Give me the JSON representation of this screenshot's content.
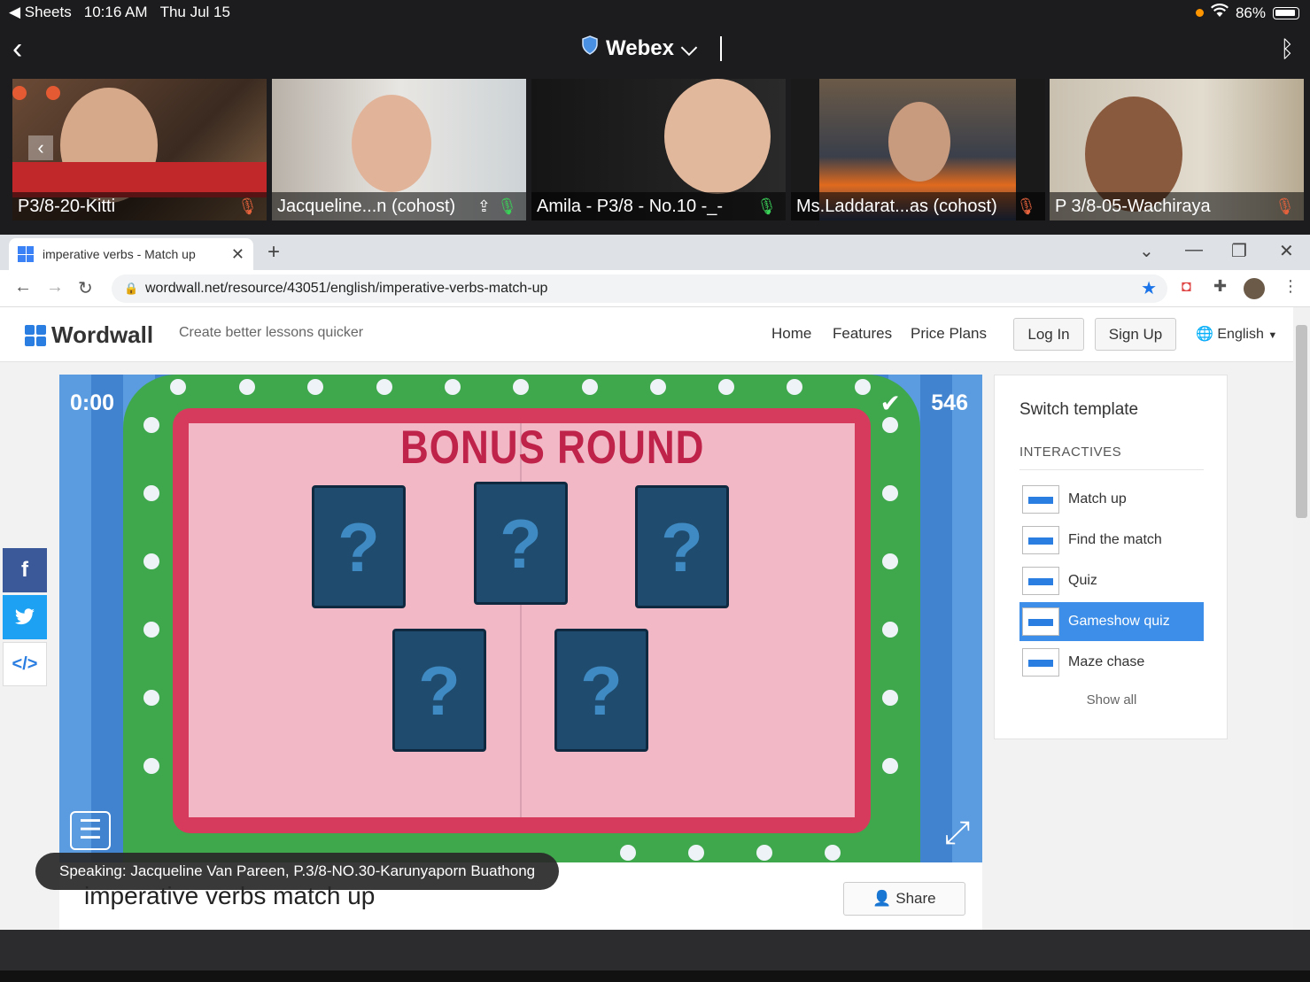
{
  "status_bar": {
    "back_app": "Sheets",
    "time": "10:16 AM",
    "date": "Thu Jul 15",
    "battery": "86%"
  },
  "webex": {
    "title": "Webex"
  },
  "participants": [
    {
      "name": "P3/8-20-Kitti"
    },
    {
      "name": "Jacqueline...n (cohost)"
    },
    {
      "name": "Amila - P3/8 - No.10 -_-"
    },
    {
      "name": "Ms.Laddarat...as (cohost)"
    },
    {
      "name": "P 3/8-05-Wachiraya"
    }
  ],
  "browser": {
    "tab_title": "imperative verbs - Match up",
    "url": "wordwall.net/resource/43051/english/imperative-verbs-match-up"
  },
  "wordwall": {
    "logo": "Wordwall",
    "tagline": "Create better lessons quicker",
    "nav": {
      "home": "Home",
      "features": "Features",
      "price_plans": "Price Plans"
    },
    "login": "Log In",
    "signup": "Sign Up",
    "language": "English"
  },
  "game": {
    "timer": "0:00",
    "score": "546",
    "heading": "BONUS ROUND",
    "cards": [
      "?",
      "?",
      "?",
      "?",
      "?"
    ]
  },
  "panel": {
    "title": "Switch template",
    "section": "INTERACTIVES",
    "templates": [
      {
        "label": "Match up"
      },
      {
        "label": "Find the match"
      },
      {
        "label": "Quiz"
      },
      {
        "label": "Gameshow quiz",
        "active": true
      },
      {
        "label": "Maze chase"
      }
    ],
    "show_all": "Show all"
  },
  "activity": {
    "title": "imperative verbs match up",
    "share": "Share"
  },
  "speaking": "Speaking: Jacqueline Van Pareen, P.3/8-NO.30-Karunyaporn Buathong",
  "colors": {
    "accent": "#3d8ee8",
    "board_green": "#3fa84d",
    "board_red": "#d63a5c",
    "card_blue": "#1e4b6e"
  }
}
